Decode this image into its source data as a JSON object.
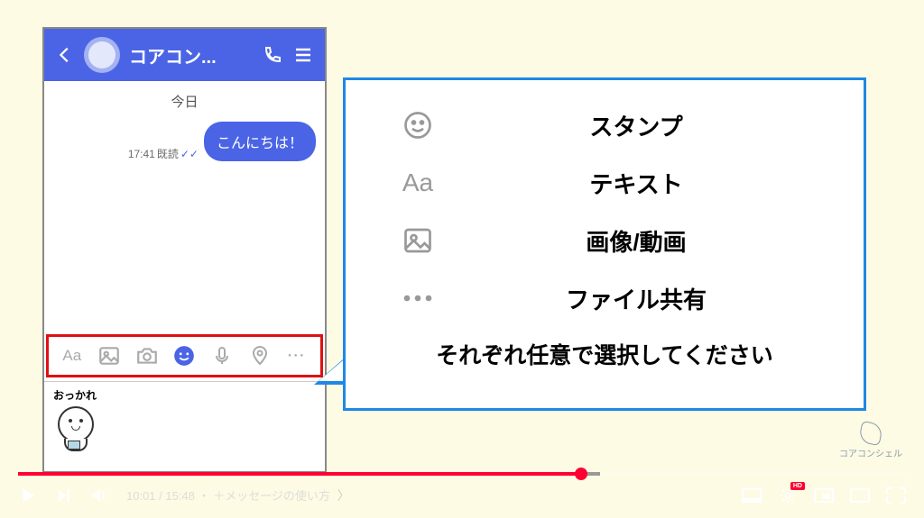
{
  "phone": {
    "contact_name": "コアコン...",
    "chat": {
      "date": "今日",
      "message": {
        "time": "17:41",
        "status": "既読",
        "text": "こんにちは！"
      }
    },
    "sticker_caption": "おっかれ"
  },
  "callout": {
    "items": [
      {
        "icon": "smile",
        "label": "スタンプ"
      },
      {
        "icon": "Aa",
        "label": "テキスト"
      },
      {
        "icon": "image",
        "label": "画像/動画"
      },
      {
        "icon": "dots",
        "label": "ファイル共有"
      }
    ],
    "instruction": "それぞれ任意で選択してください"
  },
  "brand": "コアコンシェル",
  "player": {
    "current_time": "10:01",
    "duration": "15:48",
    "chapter": "＋メッセージの使い方",
    "quality_badge": "HD"
  }
}
